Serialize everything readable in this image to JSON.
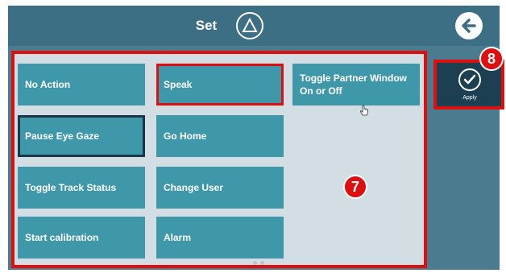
{
  "header": {
    "title": "Set",
    "triangle_icon": "triangle-up-icon",
    "back_icon": "arrow-left-circle-icon"
  },
  "tiles": [
    {
      "label": "No Action"
    },
    {
      "label": "Pause Eye Gaze"
    },
    {
      "label": "Toggle Track Status"
    },
    {
      "label": "Start calibration"
    },
    {
      "label": "Speak"
    },
    {
      "label": "Go Home"
    },
    {
      "label": "Change User"
    },
    {
      "label": "Alarm"
    },
    {
      "label": "Toggle Partner Window On or Off"
    }
  ],
  "callouts": {
    "panel": "7",
    "apply": "8"
  },
  "apply": {
    "label": "Apply",
    "icon": "checkmark-circle-icon"
  },
  "colors": {
    "background": "#4a7b8f",
    "header": "#3d6f84",
    "tile": "#3f98aa",
    "panel": "#d3dde4",
    "highlight_red": "#dd0f0f",
    "apply_bg": "#1c3f52"
  }
}
